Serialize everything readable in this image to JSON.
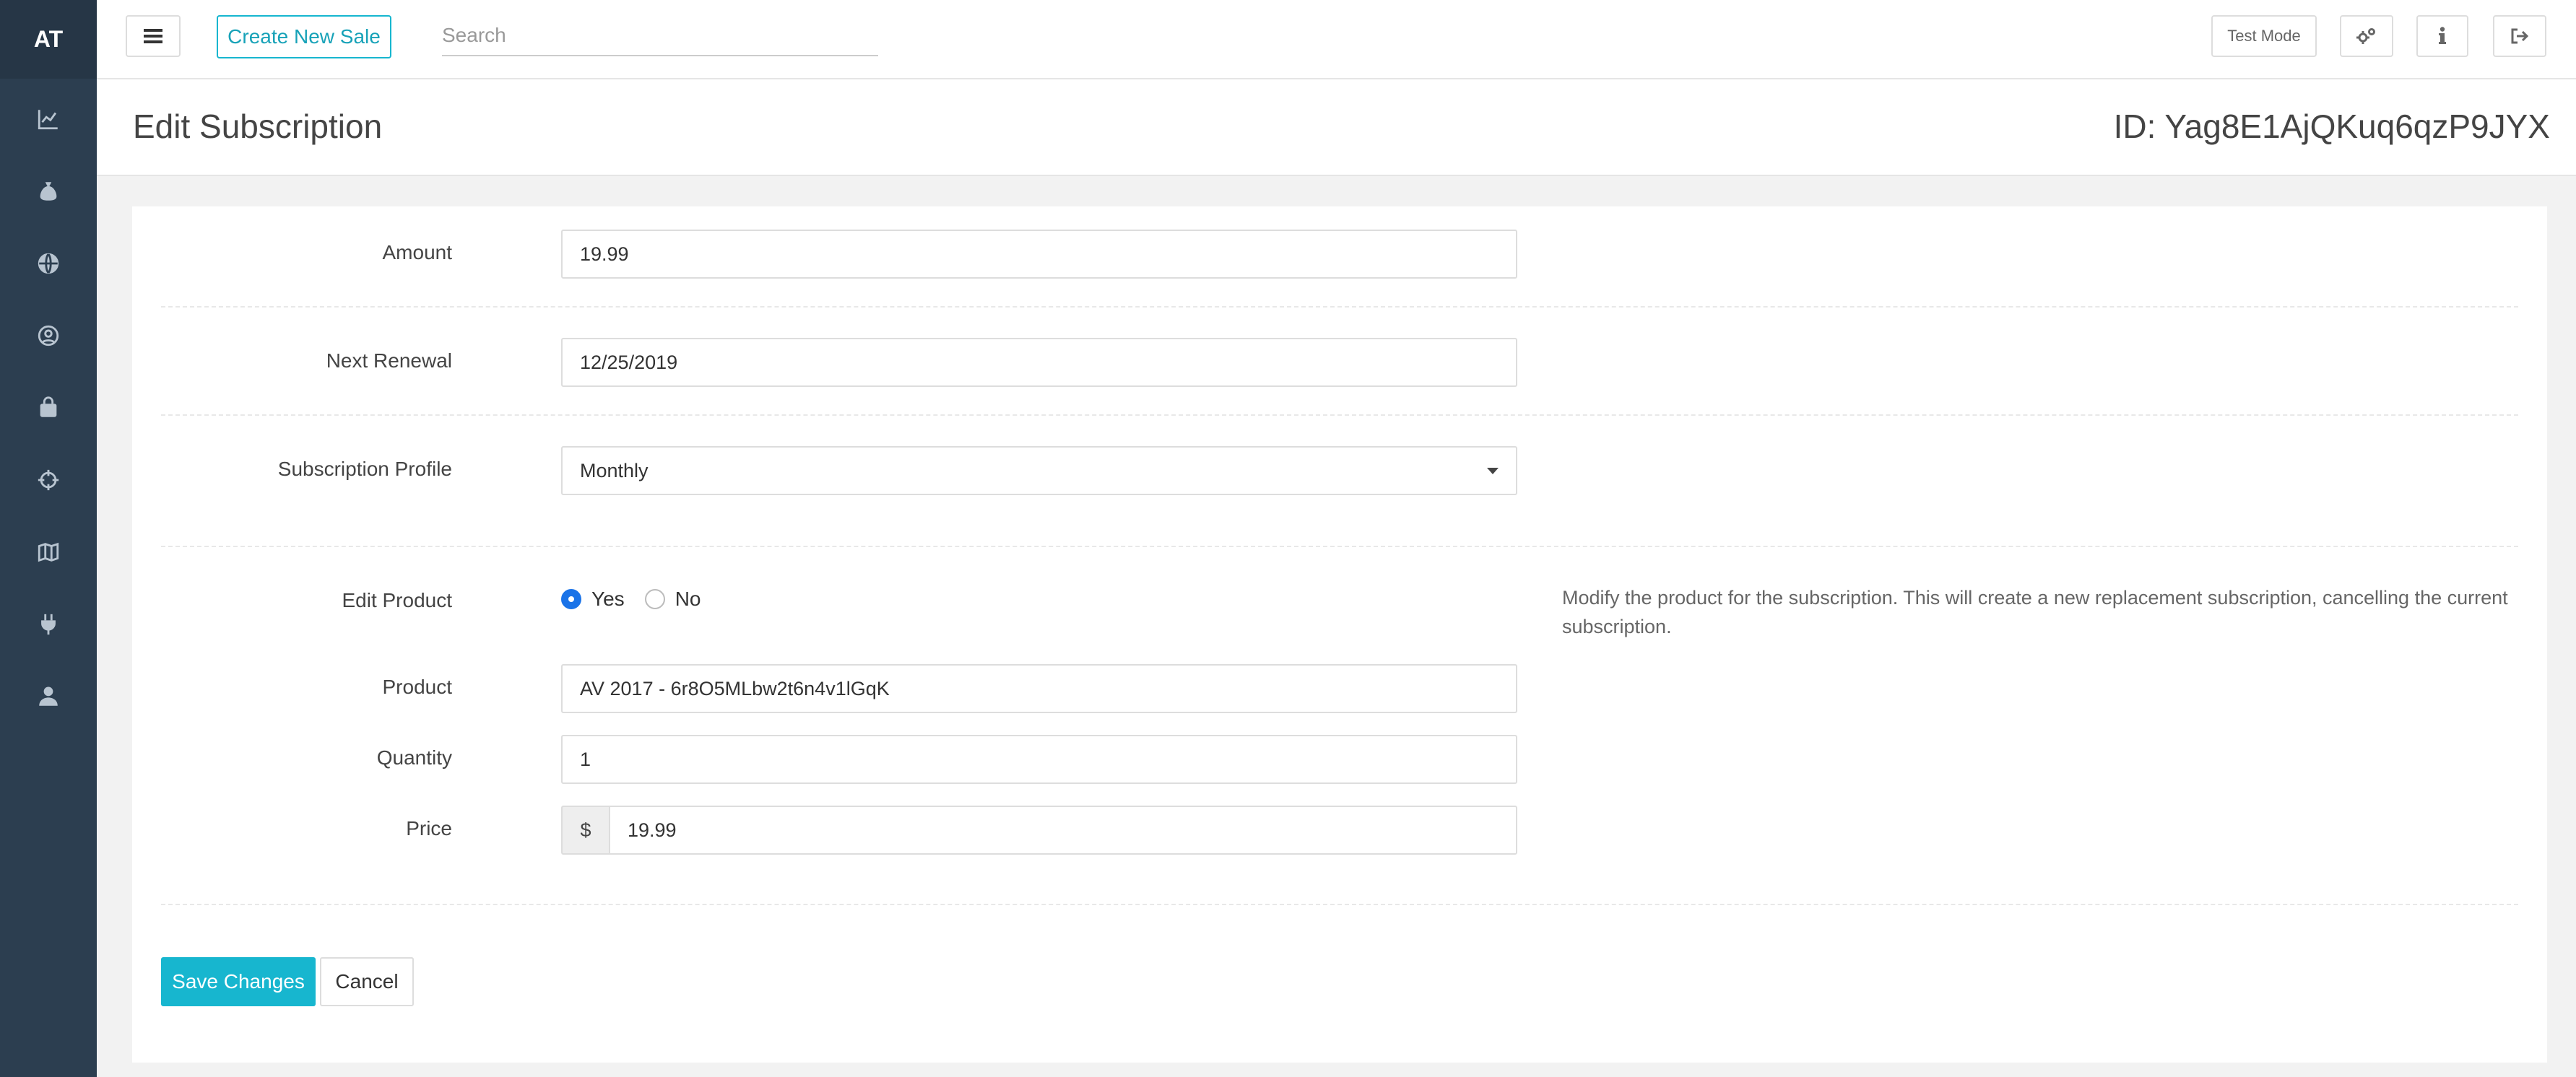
{
  "sidebar": {
    "brand": "AT",
    "icons": [
      "chart-line-icon",
      "money-bag-icon",
      "globe-icon",
      "user-circle-icon",
      "shopping-bag-icon",
      "crosshairs-icon",
      "map-icon",
      "plug-icon",
      "user-icon"
    ]
  },
  "topbar": {
    "menu_icon": "bars-icon",
    "create_sale_label": "Create New Sale",
    "search_placeholder": "Search",
    "test_mode_label": "Test Mode",
    "settings_icon": "cogs-icon",
    "info_icon": "info-icon",
    "logout_icon": "sign-out-icon"
  },
  "header": {
    "title": "Edit Subscription",
    "id_text": "ID: Yag8E1AjQKuq6qzP9JYX"
  },
  "form": {
    "amount": {
      "label": "Amount",
      "value": "19.99"
    },
    "next_renewal": {
      "label": "Next Renewal",
      "value": "12/25/2019"
    },
    "subscription_profile": {
      "label": "Subscription Profile",
      "value": "Monthly"
    },
    "edit_product": {
      "label": "Edit Product",
      "options": [
        {
          "label": "Yes",
          "checked": true
        },
        {
          "label": "No",
          "checked": false
        }
      ],
      "help": "Modify the product for the subscription. This will create a new replacement subscription, cancelling the current subscription."
    },
    "product": {
      "label": "Product",
      "value": "AV 2017 - 6r8O5MLbw2t6n4v1lGqK"
    },
    "quantity": {
      "label": "Quantity",
      "value": "1"
    },
    "price": {
      "label": "Price",
      "currency": "$",
      "value": "19.99"
    }
  },
  "actions": {
    "save_label": "Save Changes",
    "cancel_label": "Cancel"
  },
  "colors": {
    "sidebar_bg": "#2c3e50",
    "accent": "#17b6cf",
    "radio_checked": "#1a73e8"
  }
}
